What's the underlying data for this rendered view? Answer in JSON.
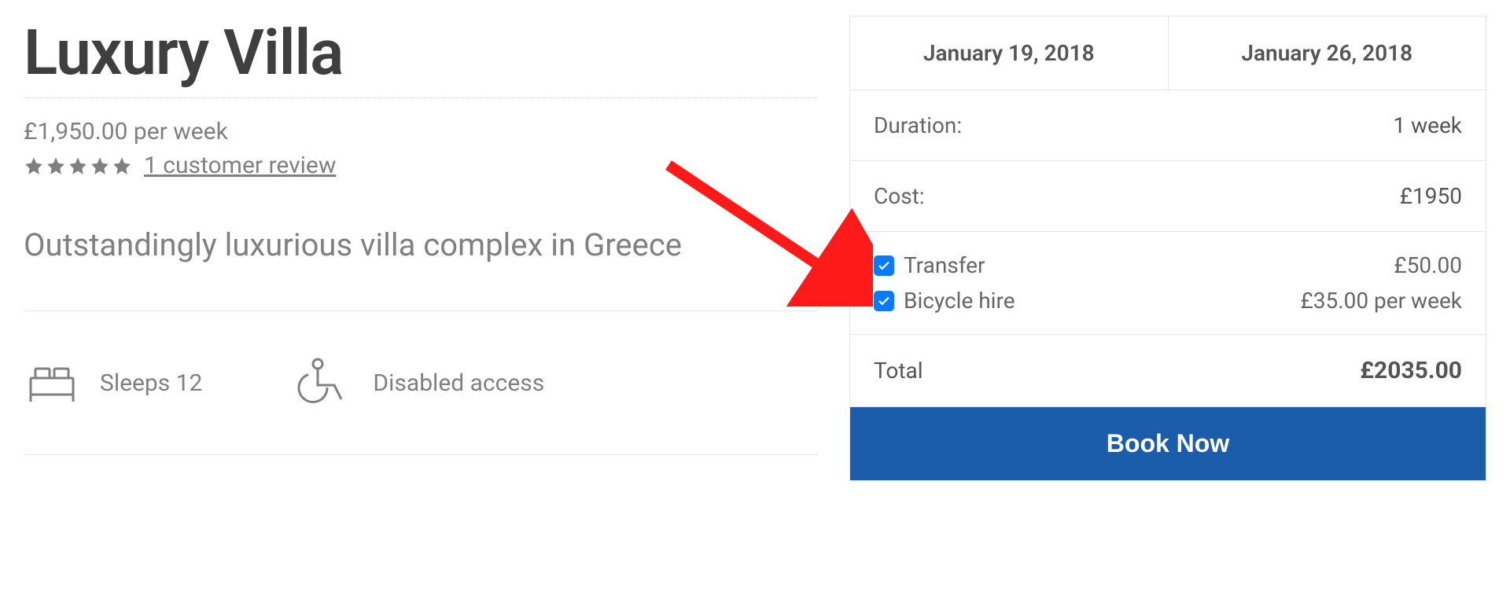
{
  "title": "Luxury Villa",
  "price_line": "£1,950.00 per week",
  "review_count": "1 customer review",
  "tagline": "Outstandingly luxurious villa complex in Greece",
  "features": {
    "sleeps": "Sleeps 12",
    "accessible": "Disabled access"
  },
  "booking": {
    "date_from": "January 19, 2018",
    "date_to": "January 26, 2018",
    "duration_label": "Duration:",
    "duration_value": "1 week",
    "cost_label": "Cost:",
    "cost_value": "£1950",
    "options": [
      {
        "label": "Transfer",
        "price": "£50.00",
        "checked": true
      },
      {
        "label": "Bicycle hire",
        "price": "£35.00 per week",
        "checked": true
      }
    ],
    "total_label": "Total",
    "total_value": "£2035.00",
    "book_button": "Book Now"
  }
}
